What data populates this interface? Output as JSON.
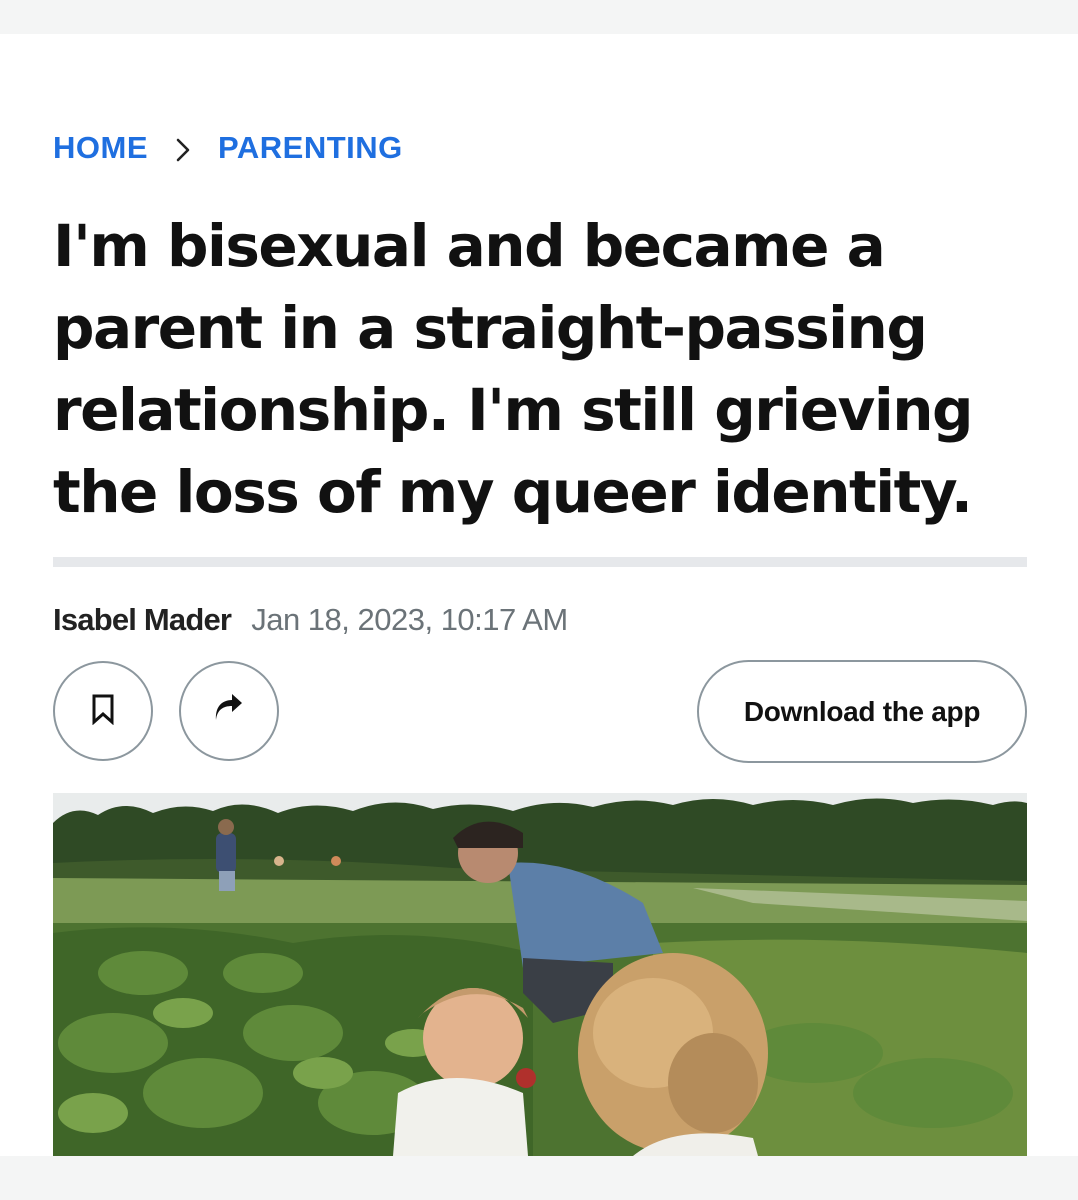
{
  "breadcrumb": {
    "home": "HOME",
    "section": "PARENTING"
  },
  "article": {
    "headline": "I'm bisexual and became a parent in a straight-passing relationship. I'm still grieving the loss of my queer identity.",
    "author": "Isabel Mader",
    "date": "Jan 18, 2023, 10:17 AM"
  },
  "actions": {
    "bookmark_icon": "bookmark-icon",
    "share_icon": "share-arrow-icon",
    "download_label": "Download the app"
  },
  "colors": {
    "link": "#1f6fe0",
    "headline": "#111111",
    "meta": "#6b7378",
    "button_border": "#8c979e"
  }
}
